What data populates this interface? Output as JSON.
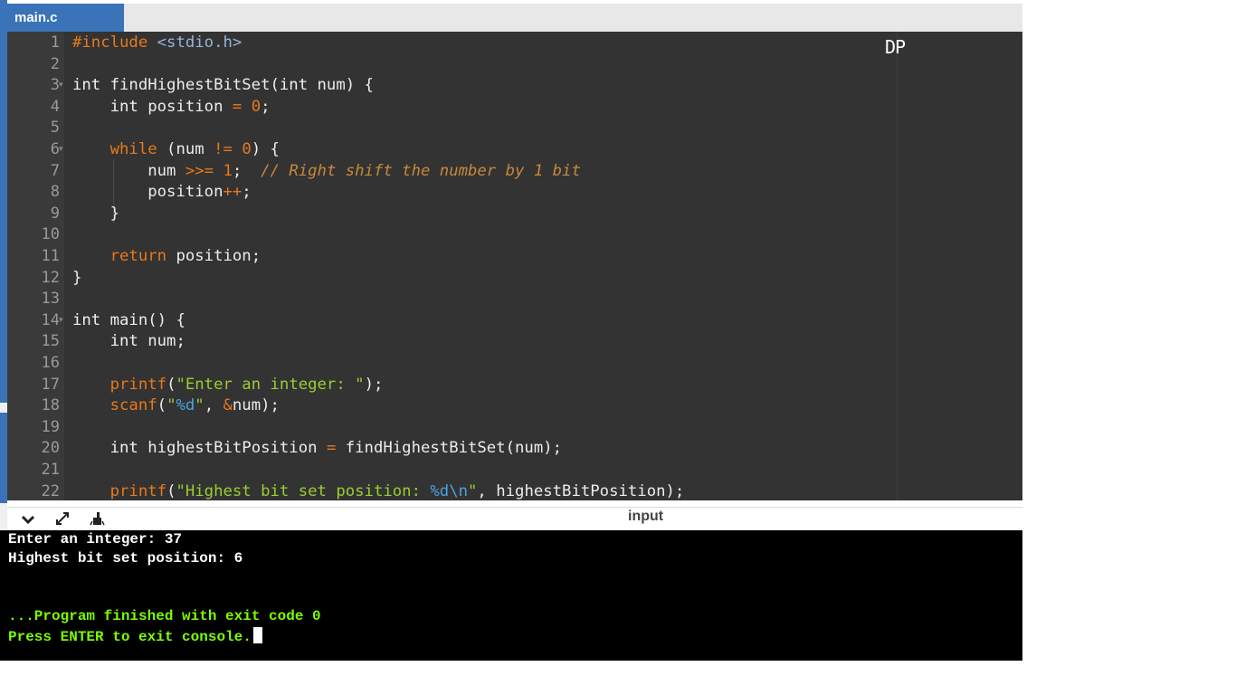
{
  "tab": {
    "filename": "main.c"
  },
  "editor": {
    "watermark": "DP",
    "lines": [
      {
        "n": "1",
        "html": "<span class=\"inc\">#include</span> <span class=\"hdr\">&lt;stdio.h&gt;</span>"
      },
      {
        "n": "2",
        "html": ""
      },
      {
        "n": "3",
        "html": "<span class=\"ty\">int</span> findHighestBitSet(<span class=\"ty\">int</span> num) {",
        "fold": true
      },
      {
        "n": "4",
        "html": "    <span class=\"ty\">int</span> position <span class=\"op\">=</span> <span class=\"num\">0</span>;"
      },
      {
        "n": "5",
        "html": ""
      },
      {
        "n": "6",
        "html": "    <span class=\"kw\">while</span> (num <span class=\"op\">!=</span> <span class=\"num\">0</span>) {",
        "fold": true
      },
      {
        "n": "7",
        "html": "        num <span class=\"op\">&gt;&gt;=</span> <span class=\"num\">1</span>;  <span class=\"cmt\">// Right shift the number by 1 bit</span>"
      },
      {
        "n": "8",
        "html": "        position<span class=\"op\">++</span>;"
      },
      {
        "n": "9",
        "html": "    }"
      },
      {
        "n": "10",
        "html": ""
      },
      {
        "n": "11",
        "html": "    <span class=\"kw\">return</span> position;"
      },
      {
        "n": "12",
        "html": "}"
      },
      {
        "n": "13",
        "html": ""
      },
      {
        "n": "14",
        "html": "<span class=\"ty\">int</span> main() {",
        "fold": true
      },
      {
        "n": "15",
        "html": "    <span class=\"ty\">int</span> num;"
      },
      {
        "n": "16",
        "html": ""
      },
      {
        "n": "17",
        "html": "    <span class=\"fn\">printf</span>(<span class=\"str\">\"Enter an integer: \"</span>);"
      },
      {
        "n": "18",
        "html": "    <span class=\"fn\">scanf</span>(<span class=\"str\">\"<span class=\"esc\">%d</span>\"</span>, <span class=\"op\">&amp;</span>num);"
      },
      {
        "n": "19",
        "html": ""
      },
      {
        "n": "20",
        "html": "    <span class=\"ty\">int</span> highestBitPosition <span class=\"op\">=</span> findHighestBitSet(num);"
      },
      {
        "n": "21",
        "html": ""
      },
      {
        "n": "22",
        "html": "    <span class=\"fn\">printf</span>(<span class=\"str\">\"Highest bit set position: <span class=\"esc\">%d\\n</span>\"</span>, highestBitPosition);"
      }
    ]
  },
  "console_bar": {
    "collapse_icon": "chevron-down-icon",
    "expand_icon": "expand-arrows-icon",
    "clear_icon": "clear-console-icon",
    "input_label": "input"
  },
  "console": {
    "lines": [
      {
        "text": "Enter an integer: 37",
        "color": "white"
      },
      {
        "text": "Highest bit set position: 6",
        "color": "white"
      },
      {
        "text": "",
        "color": "white"
      },
      {
        "text": "",
        "color": "white"
      },
      {
        "text": "...Program finished with exit code 0",
        "color": "green"
      },
      {
        "text": "Press ENTER to exit console.",
        "color": "green",
        "cursor": true
      }
    ]
  },
  "colors": {
    "accent": "#3a73b8",
    "editor_bg": "#333333",
    "keyword": "#e8791b",
    "string": "#9acd32",
    "console_green": "#7cfc00"
  }
}
